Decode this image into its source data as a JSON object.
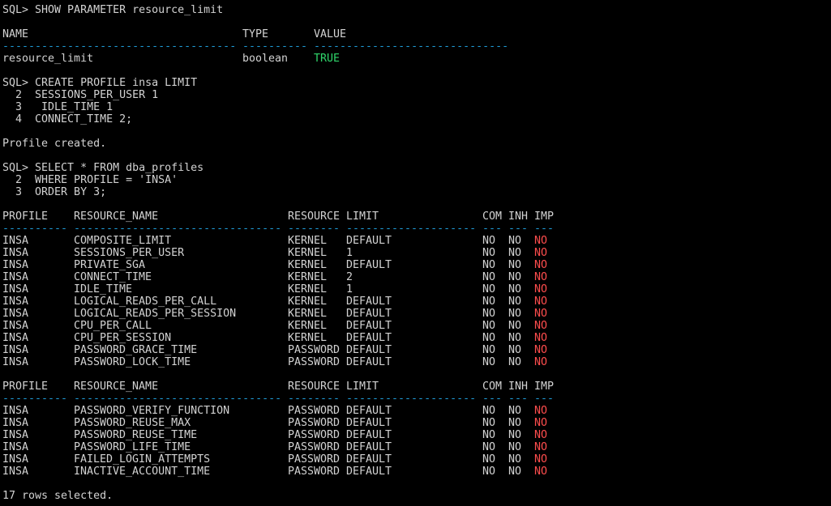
{
  "colors": {
    "background": "#000000",
    "text": "#d2d2d2",
    "separator": "#1f9bd7",
    "true_value": "#2fd56a",
    "no_value": "#ff4d4d"
  },
  "show_param": {
    "command": "SQL> SHOW PARAMETER resource_limit",
    "headers": [
      "NAME",
      "TYPE",
      "VALUE"
    ],
    "separators": [
      "------------------------------------",
      "----------",
      "------------------------------"
    ],
    "row": {
      "name": "resource_limit",
      "type": "boolean",
      "value": "TRUE"
    }
  },
  "create_profile": {
    "lines": [
      "SQL> CREATE PROFILE insa LIMIT",
      "  2  SESSIONS_PER_USER 1",
      "  3   IDLE_TIME 1",
      "  4  CONNECT_TIME 2;"
    ],
    "result": "Profile created."
  },
  "select_query": {
    "lines": [
      "SQL> SELECT * FROM dba_profiles",
      "  2  WHERE PROFILE = 'INSA'",
      "  3  ORDER BY 3;"
    ]
  },
  "table": {
    "headers": [
      "PROFILE",
      "RESOURCE_NAME",
      "RESOURCE",
      "LIMIT",
      "COM",
      "INH",
      "IMP"
    ],
    "separators": [
      "----------",
      "--------------------------------",
      "--------",
      "--------------------",
      "---",
      "---",
      "---"
    ],
    "block1": [
      {
        "profile": "INSA",
        "resource_name": "COMPOSITE_LIMIT",
        "resource": "KERNEL",
        "limit": "DEFAULT",
        "com": "NO",
        "inh": "NO",
        "imp": "NO"
      },
      {
        "profile": "INSA",
        "resource_name": "SESSIONS_PER_USER",
        "resource": "KERNEL",
        "limit": "1",
        "com": "NO",
        "inh": "NO",
        "imp": "NO"
      },
      {
        "profile": "INSA",
        "resource_name": "PRIVATE_SGA",
        "resource": "KERNEL",
        "limit": "DEFAULT",
        "com": "NO",
        "inh": "NO",
        "imp": "NO"
      },
      {
        "profile": "INSA",
        "resource_name": "CONNECT_TIME",
        "resource": "KERNEL",
        "limit": "2",
        "com": "NO",
        "inh": "NO",
        "imp": "NO"
      },
      {
        "profile": "INSA",
        "resource_name": "IDLE_TIME",
        "resource": "KERNEL",
        "limit": "1",
        "com": "NO",
        "inh": "NO",
        "imp": "NO"
      },
      {
        "profile": "INSA",
        "resource_name": "LOGICAL_READS_PER_CALL",
        "resource": "KERNEL",
        "limit": "DEFAULT",
        "com": "NO",
        "inh": "NO",
        "imp": "NO"
      },
      {
        "profile": "INSA",
        "resource_name": "LOGICAL_READS_PER_SESSION",
        "resource": "KERNEL",
        "limit": "DEFAULT",
        "com": "NO",
        "inh": "NO",
        "imp": "NO"
      },
      {
        "profile": "INSA",
        "resource_name": "CPU_PER_CALL",
        "resource": "KERNEL",
        "limit": "DEFAULT",
        "com": "NO",
        "inh": "NO",
        "imp": "NO"
      },
      {
        "profile": "INSA",
        "resource_name": "CPU_PER_SESSION",
        "resource": "KERNEL",
        "limit": "DEFAULT",
        "com": "NO",
        "inh": "NO",
        "imp": "NO"
      },
      {
        "profile": "INSA",
        "resource_name": "PASSWORD_GRACE_TIME",
        "resource": "PASSWORD",
        "limit": "DEFAULT",
        "com": "NO",
        "inh": "NO",
        "imp": "NO"
      },
      {
        "profile": "INSA",
        "resource_name": "PASSWORD_LOCK_TIME",
        "resource": "PASSWORD",
        "limit": "DEFAULT",
        "com": "NO",
        "inh": "NO",
        "imp": "NO"
      }
    ],
    "block2": [
      {
        "profile": "INSA",
        "resource_name": "PASSWORD_VERIFY_FUNCTION",
        "resource": "PASSWORD",
        "limit": "DEFAULT",
        "com": "NO",
        "inh": "NO",
        "imp": "NO"
      },
      {
        "profile": "INSA",
        "resource_name": "PASSWORD_REUSE_MAX",
        "resource": "PASSWORD",
        "limit": "DEFAULT",
        "com": "NO",
        "inh": "NO",
        "imp": "NO"
      },
      {
        "profile": "INSA",
        "resource_name": "PASSWORD_REUSE_TIME",
        "resource": "PASSWORD",
        "limit": "DEFAULT",
        "com": "NO",
        "inh": "NO",
        "imp": "NO"
      },
      {
        "profile": "INSA",
        "resource_name": "PASSWORD_LIFE_TIME",
        "resource": "PASSWORD",
        "limit": "DEFAULT",
        "com": "NO",
        "inh": "NO",
        "imp": "NO"
      },
      {
        "profile": "INSA",
        "resource_name": "FAILED_LOGIN_ATTEMPTS",
        "resource": "PASSWORD",
        "limit": "DEFAULT",
        "com": "NO",
        "inh": "NO",
        "imp": "NO"
      },
      {
        "profile": "INSA",
        "resource_name": "INACTIVE_ACCOUNT_TIME",
        "resource": "PASSWORD",
        "limit": "DEFAULT",
        "com": "NO",
        "inh": "NO",
        "imp": "NO"
      }
    ]
  },
  "footer": "17 rows selected."
}
